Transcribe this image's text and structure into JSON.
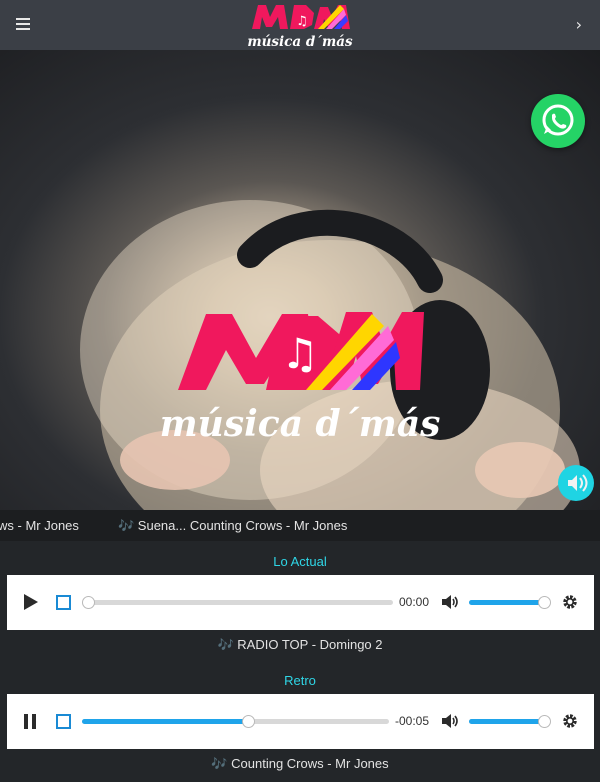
{
  "header": {
    "logo_text": "MDM",
    "logo_tagline": "música d´más",
    "menu_icon": "hamburger-icon",
    "next_icon": "chevron-right-icon",
    "next_glyph": "›"
  },
  "hero": {
    "logo_text": "MDM",
    "logo_tagline": "música d´más",
    "whatsapp_icon": "whatsapp-icon",
    "sound_icon": "speaker-icon"
  },
  "ticker": {
    "left_text": "ws - Mr Jones",
    "main_text": "🎶 Suena... Counting Crows - Mr Jones"
  },
  "players": [
    {
      "title": "Lo Actual",
      "state": "paused",
      "time": "00:00",
      "progress": 0,
      "volume": 1,
      "now_playing": "🎶 RADIO TOP - Domingo 2"
    },
    {
      "title": "Retro",
      "state": "playing",
      "time": "-00:05",
      "progress": 0.54,
      "volume": 1,
      "now_playing": "🎶 Counting Crows - Mr Jones"
    }
  ],
  "colors": {
    "accent": "#2fd6e6",
    "progress": "#1fa4ea",
    "logo_pink": "#f0185d",
    "logo_yellow": "#ffd600",
    "whatsapp": "#25d366",
    "topbar": "#3b3f46"
  }
}
